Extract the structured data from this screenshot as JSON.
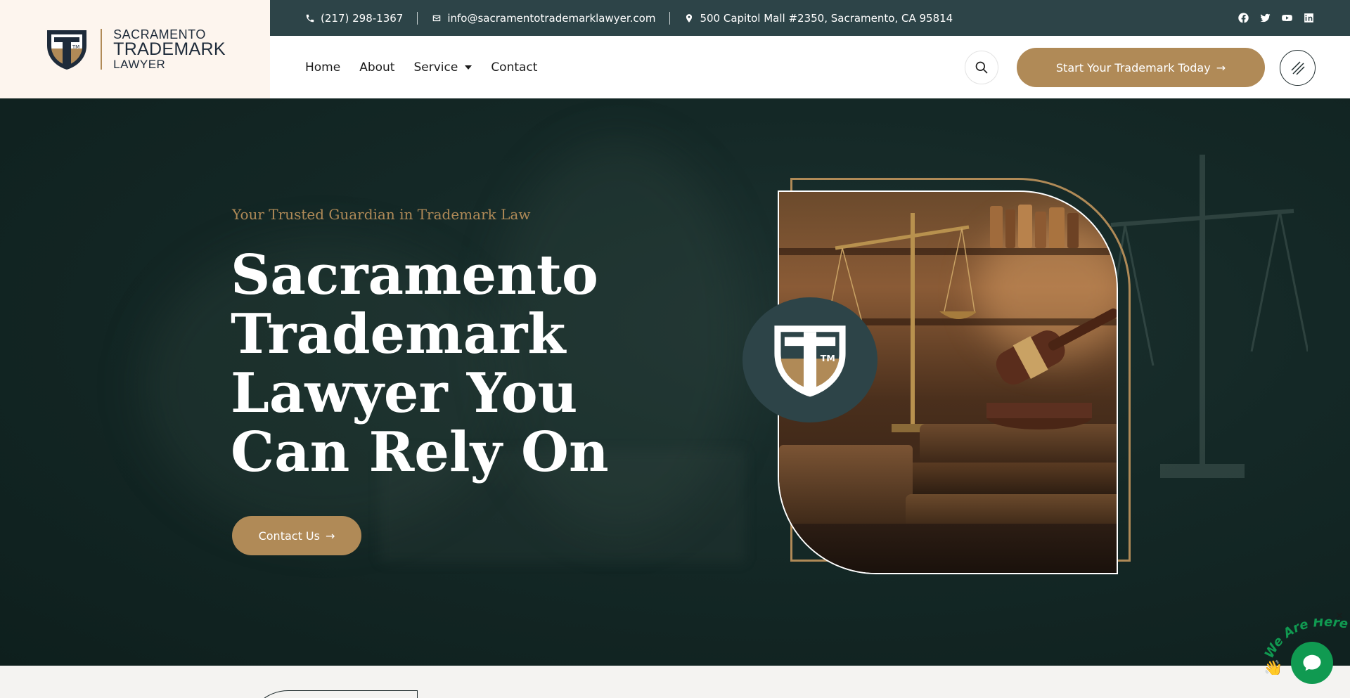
{
  "brand": {
    "line1": "SACRAMENTO",
    "line2": "TRADEMARK",
    "line3": "LAWYER",
    "logo_mark": "TM",
    "colors": {
      "accent": "#b08a57",
      "dark": "#2d4448",
      "cream": "#fdf5ee"
    }
  },
  "topbar": {
    "phone": "(217) 298-1367",
    "email": "info@sacramentotrademarklawyer.com",
    "address": "500 Capitol Mall #2350, Sacramento, CA 95814",
    "icons": {
      "phone": "phone-icon",
      "email": "envelope-icon",
      "address": "map-pin-icon"
    },
    "socials": [
      "facebook-icon",
      "twitter-icon",
      "youtube-icon",
      "linkedin-icon"
    ]
  },
  "nav": {
    "items": [
      {
        "label": "Home"
      },
      {
        "label": "About"
      },
      {
        "label": "Service",
        "has_dropdown": true
      },
      {
        "label": "Contact"
      }
    ],
    "cta_label": "Start Your Trademark Today",
    "cta_arrow": "→"
  },
  "hero": {
    "tagline": "Your Trusted Guardian in Trademark Law",
    "headline": "Sacramento Trademark Lawyer You Can Rely On",
    "button_label": "Contact Us",
    "button_arrow": "→",
    "emblem_mark": "TM"
  },
  "chat": {
    "badge_text": "We Are Here!",
    "close_symbol": "×"
  }
}
